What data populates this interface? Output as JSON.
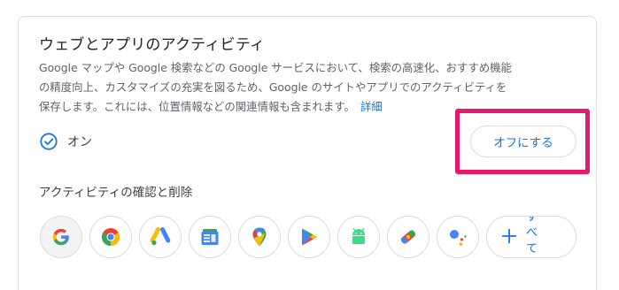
{
  "section": {
    "title": "ウェブとアプリのアクティビティ",
    "description_lines": [
      "Google マップや Google 検索などの Google サービスにおいて、検索の高速化、おすすめ機能",
      "の精度向上、カスタマイズの充実を図るため、Google のサイトやアプリでのアクティビティを",
      "保存します。これには、位置情報などの関連情報も含まれます。"
    ],
    "details_link": "詳細",
    "status_label": "オン",
    "turn_off_button": "オフにする",
    "review_title": "アクティビティの確認と削除",
    "show_all_label": "すべて表示"
  },
  "colors": {
    "accent": "#1a73e8",
    "highlight": "#e8196d",
    "border": "#dadce0"
  },
  "apps": [
    {
      "icon": "google-icon"
    },
    {
      "icon": "chrome-icon"
    },
    {
      "icon": "google-ads-icon"
    },
    {
      "icon": "google-news-icon"
    },
    {
      "icon": "google-maps-icon"
    },
    {
      "icon": "google-play-icon"
    },
    {
      "icon": "android-icon"
    },
    {
      "icon": "google-lens-icon"
    },
    {
      "icon": "google-assistant-icon"
    }
  ]
}
